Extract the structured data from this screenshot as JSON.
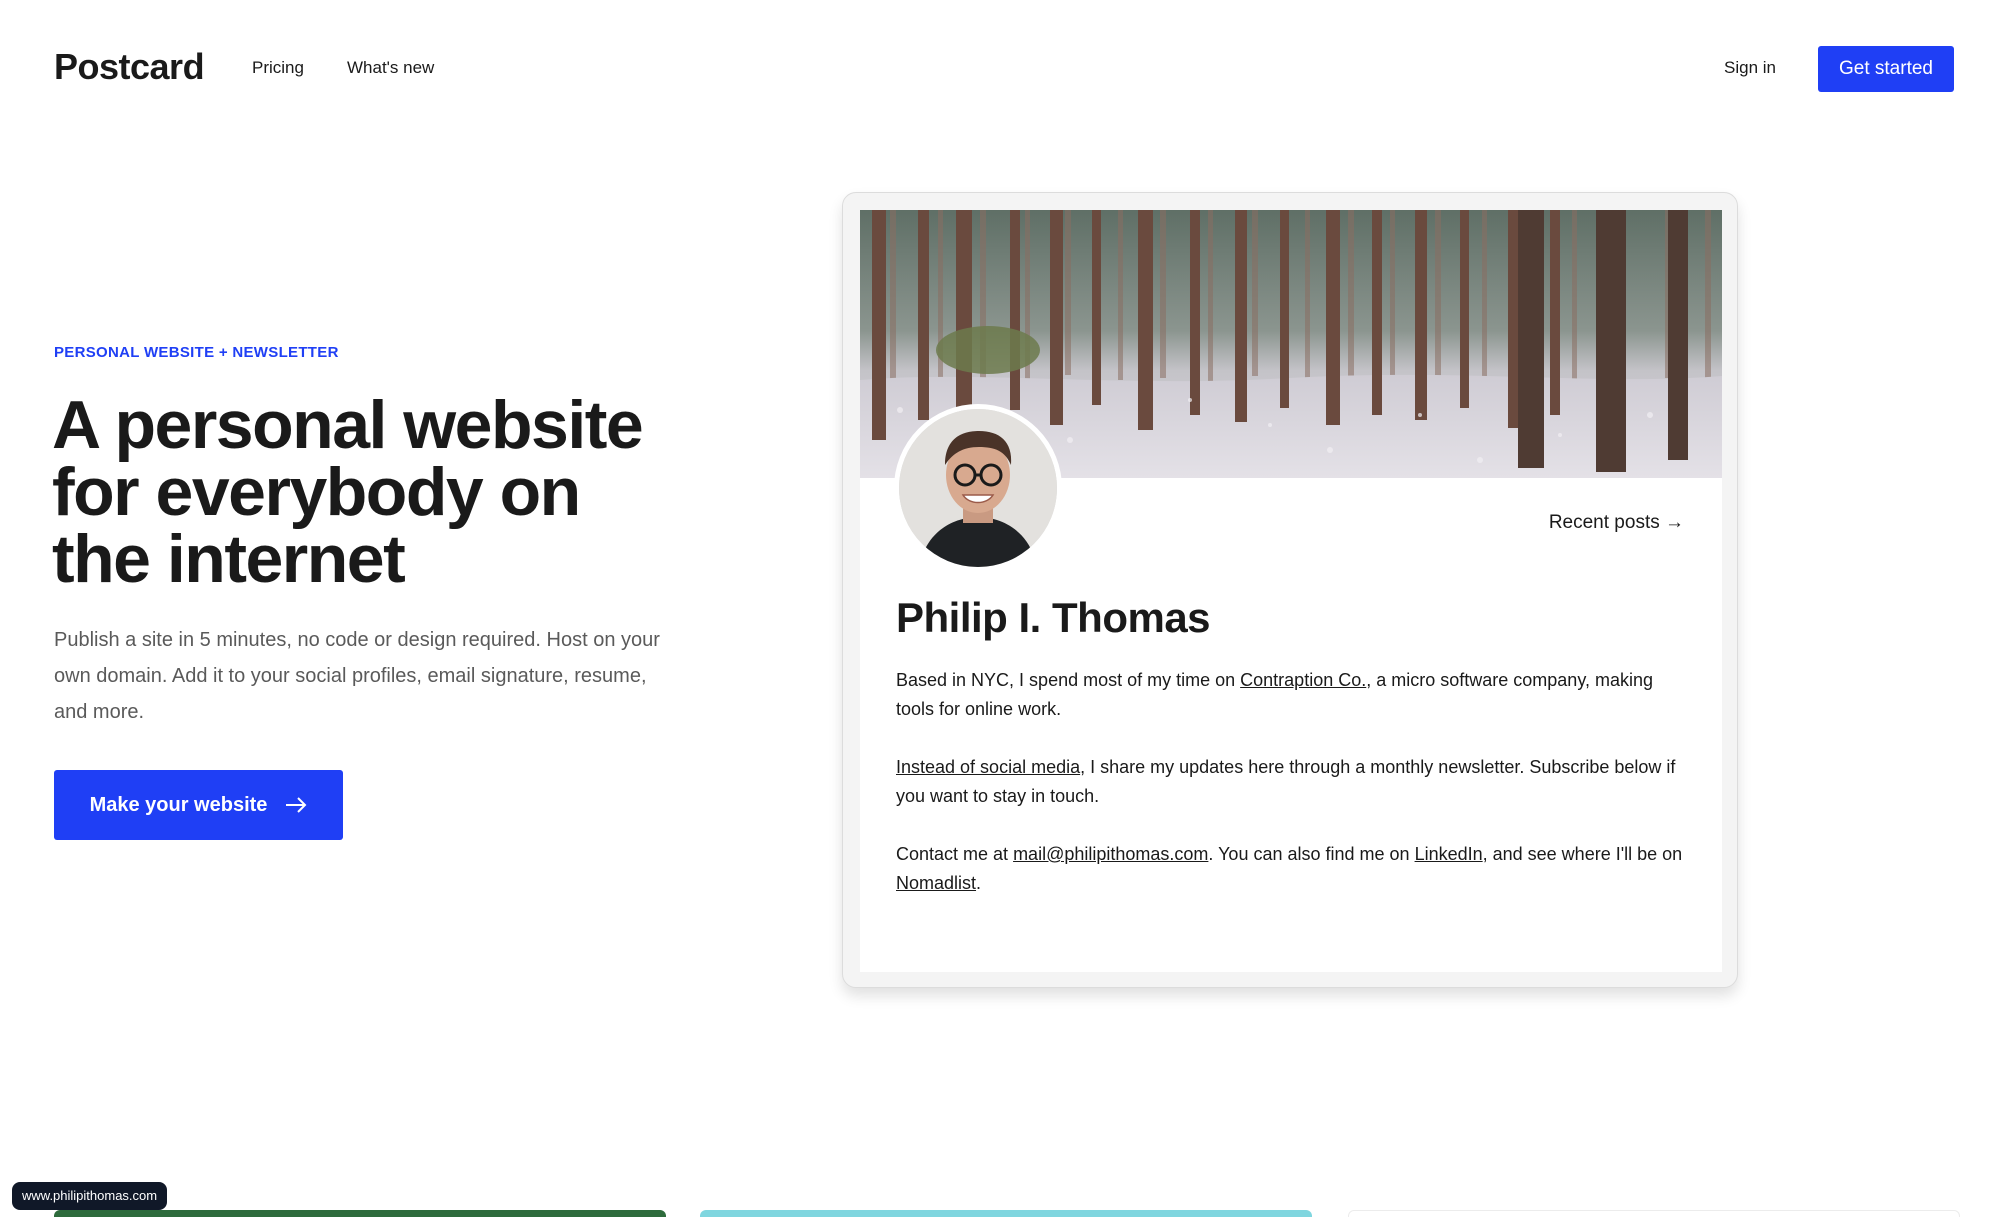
{
  "header": {
    "logo": "Postcard",
    "nav": {
      "pricing": "Pricing",
      "whats_new": "What's new"
    },
    "sign_in": "Sign in",
    "get_started": "Get started"
  },
  "hero": {
    "eyebrow": "PERSONAL WEBSITE + NEWSLETTER",
    "headline": "A personal website for everybody on the internet",
    "subcopy": "Publish a site in 5 minutes, no code or design required. Host on your own domain. Add it to your social profiles, email signature, resume, and more.",
    "cta": "Make your website"
  },
  "preview": {
    "recent_posts": "Recent posts →",
    "name": "Philip I. Thomas",
    "bio1": {
      "pre": "Based in NYC, I spend most of my time on ",
      "link": "Contraption Co.",
      "post": ", a micro software company, making tools for online work."
    },
    "bio2": {
      "link": "Instead of social media",
      "post": ", I share my updates here through a monthly newsletter. Subscribe below if you want to stay in touch."
    },
    "bio3": {
      "pre": "Contact me at ",
      "email": "mail@philipithomas.com",
      "mid1": ". You can also find me on ",
      "linkedin": "LinkedIn",
      "mid2": ", and see where I'll be on ",
      "nomadlist": "Nomadlist",
      "end": "."
    }
  },
  "status_url": "www.philipithomas.com",
  "colors": {
    "accent": "#1f3ff5",
    "text": "#1a1a1a",
    "muted": "#5a5a5a"
  }
}
